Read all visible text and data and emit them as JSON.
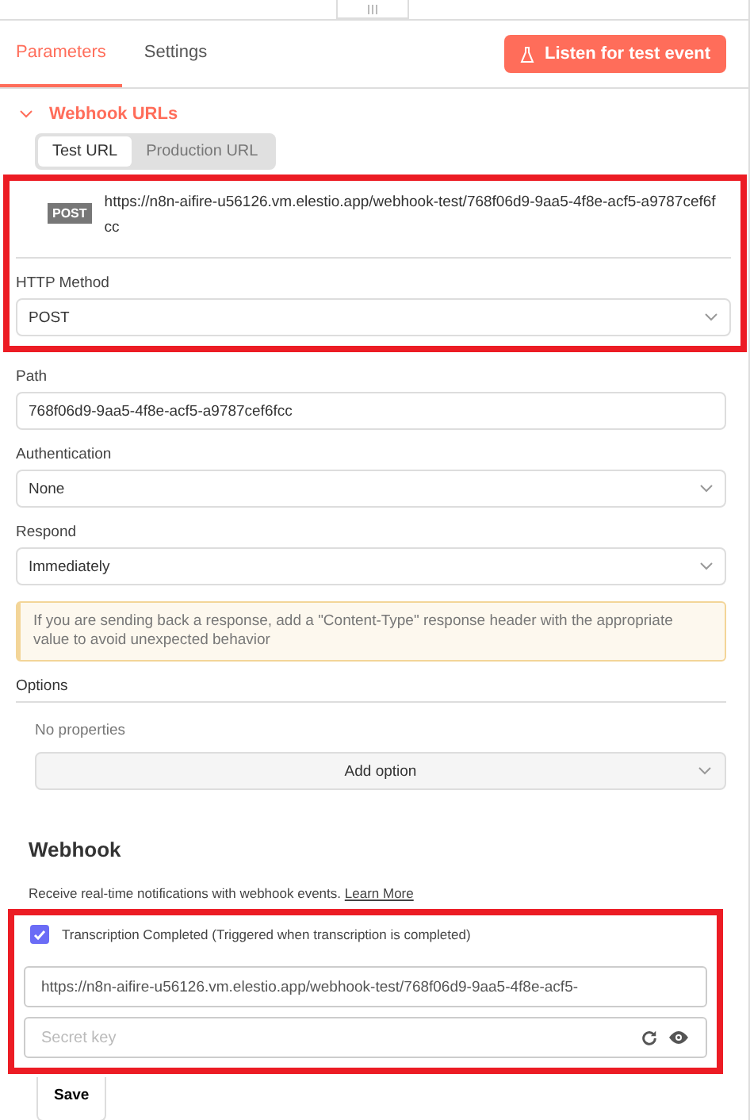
{
  "tabs": [
    {
      "label": "Parameters",
      "selected": true
    },
    {
      "label": "Settings",
      "selected": false
    }
  ],
  "listen_button": "Listen for test event",
  "section": {
    "title": "Webhook URLs",
    "expanded": true
  },
  "url_tabs": [
    {
      "label": "Test URL",
      "selected": true
    },
    {
      "label": "Production URL",
      "selected": false
    }
  ],
  "url_display": {
    "method": "POST",
    "url": "https://n8n-aifire-u56126.vm.elestio.app/webhook-test/768f06d9-9aa5-4f8e-acf5-a9787cef6fcc"
  },
  "fields": [
    {
      "kind": "select",
      "label": "HTTP Method",
      "value": "POST"
    },
    {
      "kind": "input",
      "label": "Path",
      "value": "768f06d9-9aa5-4f8e-acf5-a9787cef6fcc"
    },
    {
      "kind": "select",
      "label": "Authentication",
      "value": "None"
    },
    {
      "kind": "select",
      "label": "Respond",
      "value": "Immediately"
    }
  ],
  "notice": "If you are sending back a response, add a \"Content-Type\" response header with the appropriate value to avoid unexpected behavior",
  "options": {
    "label": "Options",
    "empty": "No properties",
    "add_button": "Add option"
  },
  "webhook": {
    "title": "Webhook",
    "description": "Receive real-time notifications with webhook events.",
    "link": "Learn More",
    "events": [
      {
        "label": "Transcription Completed (Triggered when transcription is completed)",
        "checked": true
      }
    ],
    "url_value": "https://n8n-aifire-u56126.vm.elestio.app/webhook-test/768f06d9-9aa5-4f8e-acf5-",
    "secret_placeholder": "Secret key",
    "save": "Save"
  }
}
